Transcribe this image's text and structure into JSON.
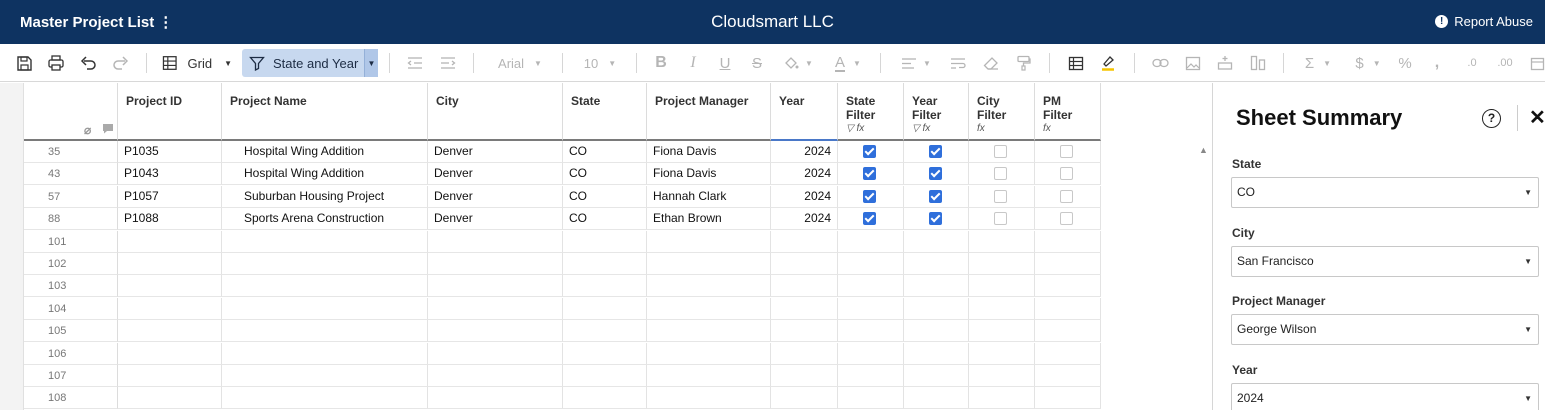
{
  "header": {
    "sheet_title": "Master Project List",
    "menu_glyph": "⋮",
    "company": "Cloudsmart LLC",
    "report_label": "Report Abuse"
  },
  "toolbar": {
    "view_label": "Grid",
    "filter_label": "State and Year",
    "font_label": "Arial",
    "size_label": "10"
  },
  "columns": {
    "project_id": "Project ID",
    "project_name": "Project Name",
    "city": "City",
    "state": "State",
    "project_manager": "Project Manager",
    "year": "Year",
    "state_filter": [
      "State",
      "Filter"
    ],
    "year_filter": [
      "Year",
      "Filter"
    ],
    "city_filter": [
      "City",
      "Filter"
    ],
    "pm_filter": "PM Filter"
  },
  "rows": [
    {
      "num": "35",
      "id": "P1035",
      "name": "Hospital Wing Addition",
      "city": "Denver",
      "state": "CO",
      "pm": "Fiona Davis",
      "year": "2024",
      "state_filter": true,
      "year_filter": true,
      "city_filter": false,
      "pm_filter": false
    },
    {
      "num": "43",
      "id": "P1043",
      "name": "Hospital Wing Addition",
      "city": "Denver",
      "state": "CO",
      "pm": "Fiona Davis",
      "year": "2024",
      "state_filter": true,
      "year_filter": true,
      "city_filter": false,
      "pm_filter": false
    },
    {
      "num": "57",
      "id": "P1057",
      "name": "Suburban Housing Project",
      "city": "Denver",
      "state": "CO",
      "pm": "Hannah Clark",
      "year": "2024",
      "state_filter": true,
      "year_filter": true,
      "city_filter": false,
      "pm_filter": false
    },
    {
      "num": "88",
      "id": "P1088",
      "name": "Sports Arena Construction",
      "city": "Denver",
      "state": "CO",
      "pm": "Ethan Brown",
      "year": "2024",
      "state_filter": true,
      "year_filter": true,
      "city_filter": false,
      "pm_filter": false
    }
  ],
  "empty_rows": [
    "101",
    "102",
    "103",
    "104",
    "105",
    "106",
    "107",
    "108"
  ],
  "summary": {
    "title": "Sheet Summary",
    "help_glyph": "?",
    "close_glyph": "✕",
    "fields": [
      {
        "label": "State",
        "value": "CO"
      },
      {
        "label": "City",
        "value": "San Francisco"
      },
      {
        "label": "Project Manager",
        "value": "George Wilson"
      },
      {
        "label": "Year",
        "value": "2024"
      }
    ]
  },
  "icons": {
    "save": "save-icon",
    "print": "print-icon",
    "undo": "undo-icon",
    "redo": "redo-icon",
    "grid": "grid-icon",
    "filter": "filter-icon",
    "bold": "bold-icon",
    "italic": "italic-icon",
    "underline": "underline-icon",
    "strikethrough": "strikethrough-icon",
    "attachment": "paperclip-icon",
    "comment": "comment-icon",
    "formula": "formula-icon",
    "sum": "sum-icon"
  },
  "colors": {
    "brand_navy": "#0e3361",
    "filter_active": "#c7d8ef",
    "checkbox_checked": "#2f6fdb",
    "highlighter": "#f5c400"
  }
}
